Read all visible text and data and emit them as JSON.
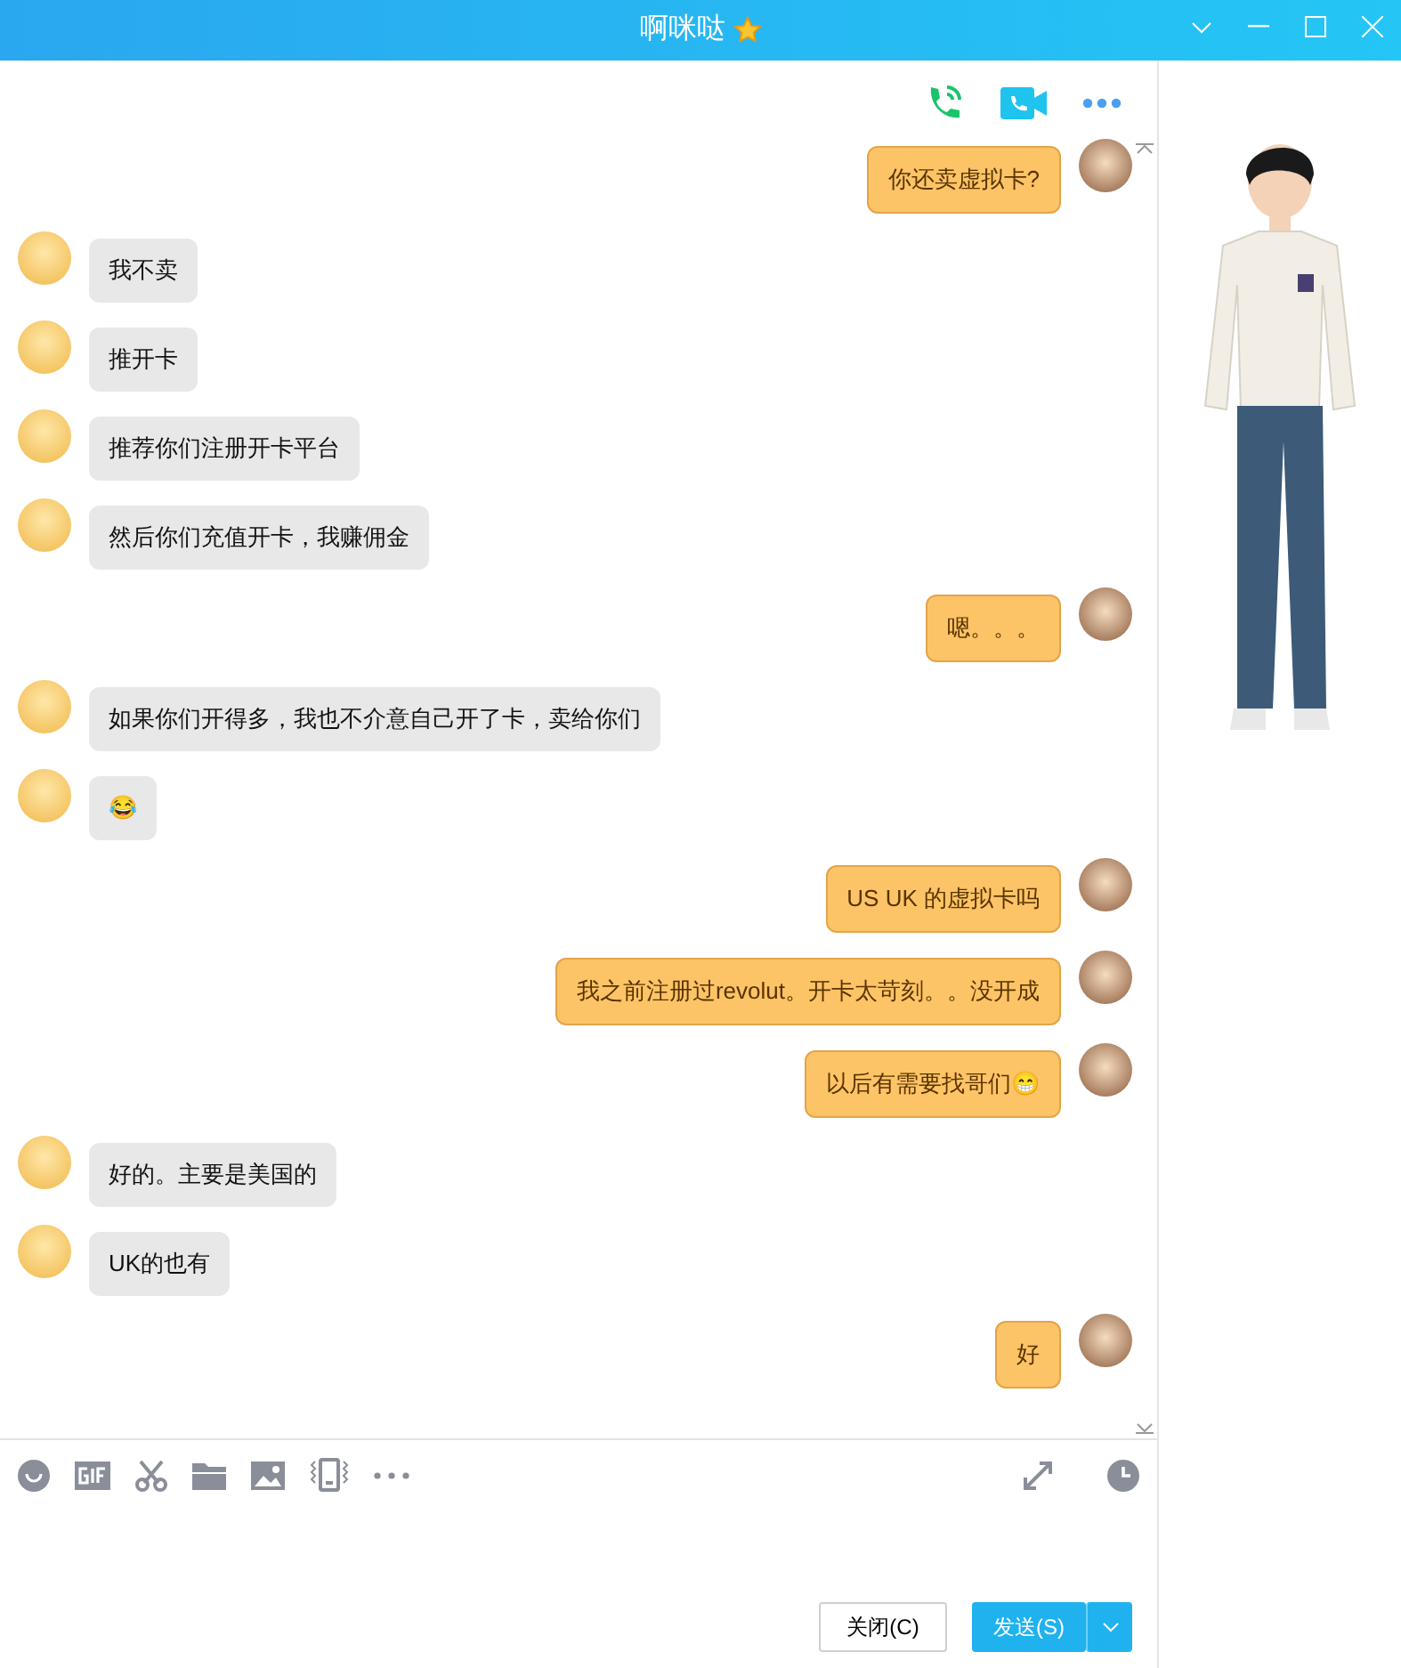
{
  "window": {
    "title": "啊咪哒"
  },
  "messages": [
    {
      "kind": "outgoing",
      "text": "你还卖虚拟卡?"
    },
    {
      "kind": "incoming",
      "text": "我不卖"
    },
    {
      "kind": "incoming",
      "text": "推开卡"
    },
    {
      "kind": "incoming",
      "text": "推荐你们注册开卡平台"
    },
    {
      "kind": "incoming",
      "text": "然后你们充值开卡，我赚佣金"
    },
    {
      "kind": "outgoing",
      "text": "嗯。。。"
    },
    {
      "kind": "incoming",
      "text": "如果你们开得多，我也不介意自己开了卡，卖给你们"
    },
    {
      "kind": "incoming",
      "text": "😂"
    },
    {
      "kind": "outgoing",
      "text": "US UK 的虚拟卡吗"
    },
    {
      "kind": "outgoing",
      "text": "我之前注册过revolut。开卡太苛刻。。没开成"
    },
    {
      "kind": "outgoing",
      "text": "以后有需要找哥们😁"
    },
    {
      "kind": "incoming",
      "text": "好的。主要是美国的"
    },
    {
      "kind": "incoming",
      "text": "UK的也有"
    },
    {
      "kind": "outgoing",
      "text": "好"
    }
  ],
  "buttons": {
    "close": "关闭(C)",
    "send": "发送(S)"
  }
}
